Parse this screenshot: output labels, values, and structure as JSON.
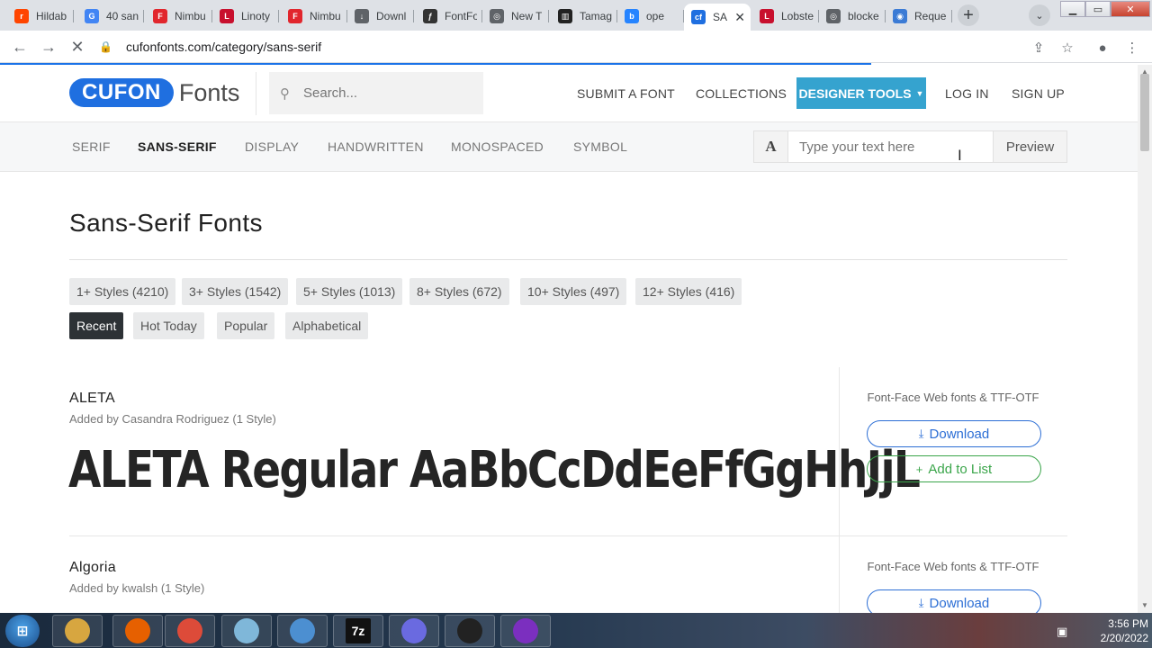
{
  "browser": {
    "tabs": [
      {
        "title": "Hildab",
        "icon": "reddit-icon",
        "color": "#ff4500",
        "glyph": "r"
      },
      {
        "title": "40 san",
        "icon": "google-icon",
        "color": "#4285f4",
        "glyph": "G"
      },
      {
        "title": "Nimbu",
        "icon": "fontface-icon",
        "color": "#e1262d",
        "glyph": "F"
      },
      {
        "title": "Linoty",
        "icon": "linotype-icon",
        "color": "#c8102e",
        "glyph": "L"
      },
      {
        "title": "Nimbu",
        "icon": "fontface-icon",
        "color": "#e1262d",
        "glyph": "F"
      },
      {
        "title": "Downl",
        "icon": "download-icon",
        "color": "#5f6368",
        "glyph": "↓"
      },
      {
        "title": "FontFo",
        "icon": "fontforge-icon",
        "color": "#333333",
        "glyph": "ƒ"
      },
      {
        "title": "New T",
        "icon": "chrome-icon",
        "color": "#5f6368",
        "glyph": "◎"
      },
      {
        "title": "Tamag",
        "icon": "tamagotchi-icon",
        "color": "#222222",
        "glyph": "▥"
      },
      {
        "title": "ope",
        "icon": "bing-icon",
        "color": "#2684ff",
        "glyph": "b"
      },
      {
        "title": "SA",
        "icon": "cufon-icon",
        "color": "#1f6fe0",
        "glyph": "cf"
      },
      {
        "title": "Lobste",
        "icon": "lobster-icon",
        "color": "#c8102e",
        "glyph": "L"
      },
      {
        "title": "blocke",
        "icon": "chrome-icon",
        "color": "#5f6368",
        "glyph": "◎"
      },
      {
        "title": "Reque",
        "icon": "globe-icon",
        "color": "#3b7bd5",
        "glyph": "◉"
      }
    ],
    "active_tab_index": 10,
    "url": "cufonfonts.com/category/sans-serif"
  },
  "site": {
    "logo_pill": "CUFON",
    "logo_word": "Fonts",
    "search_placeholder": "Search...",
    "nav": {
      "submit": "SUBMIT A FONT",
      "collections": "COLLECTIONS",
      "designer_tools": "DESIGNER TOOLS",
      "login": "LOG IN",
      "signup": "SIGN UP"
    },
    "categories": [
      "SERIF",
      "SANS-SERIF",
      "DISPLAY",
      "HANDWRITTEN",
      "MONOSPACED",
      "SYMBOL"
    ],
    "active_category": "SANS-SERIF",
    "preview": {
      "a_label": "A",
      "placeholder": "Type your text here",
      "button": "Preview"
    }
  },
  "page": {
    "title": "Sans-Serif Fonts",
    "style_filters": [
      "1+ Styles (4210)",
      "3+ Styles (1542)",
      "5+ Styles (1013)",
      "8+ Styles (672)",
      "10+ Styles (497)",
      "12+ Styles (416)"
    ],
    "sort_options": [
      "Recent",
      "Hot Today",
      "Popular",
      "Alphabetical"
    ],
    "active_sort": "Recent",
    "fonts": [
      {
        "name": "ALETA",
        "added_by": "Added by Casandra Rodriguez (1 Style)",
        "sample": "ALETA Regular AaBbCcDdEeFfGgHhJjL",
        "formats": "Font-Face Web fonts & TTF-OTF",
        "download": "Download",
        "add_to_list": "Add to List"
      },
      {
        "name": "Algoria",
        "added_by": "Added by kwalsh (1 Style)",
        "formats": "Font-Face Web fonts & TTF-OTF",
        "download": "Download"
      }
    ]
  },
  "taskbar": {
    "time": "3:56 PM",
    "date": "2/20/2022",
    "apps": [
      "explorer-icon",
      "firefox-icon",
      "chrome-icon",
      "notepad-icon",
      "control-panel-icon",
      "7zip-icon",
      "inkscape-icon",
      "fontforge-icon",
      "tor-icon"
    ],
    "app_labels": [
      "",
      "",
      "",
      "",
      "",
      "7z",
      "",
      "",
      ""
    ]
  }
}
